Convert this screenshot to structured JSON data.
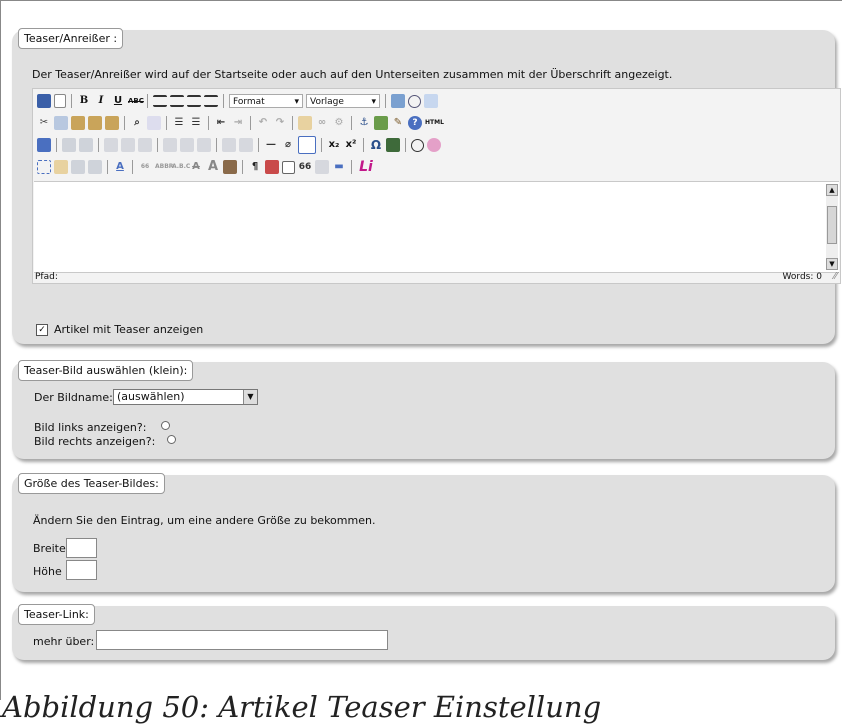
{
  "teaser_panel": {
    "legend": "Teaser/Anreißer :",
    "description": "Der Teaser/Anreißer wird auf der Startseite oder auch auf den Unterseiten zusammen mit der Überschrift angezeigt.",
    "editor": {
      "format_label": "Format",
      "style_label": "Vorlage",
      "path_label": "Pfad:",
      "word_count": "Words: 0",
      "html_label": "HTML",
      "special_char": "Ω",
      "pilcrow": "¶",
      "quote": "66",
      "italic_logo": "Li"
    },
    "show_teaser_label": "Artikel mit Teaser anzeigen",
    "show_teaser_checked": true
  },
  "image_panel": {
    "legend": "Teaser-Bild auswählen (klein):",
    "image_name_label": "Der Bildname:",
    "image_select_value": "(auswählen)",
    "left_label": "Bild links anzeigen?:",
    "right_label": "Bild rechts anzeigen?:"
  },
  "size_panel": {
    "legend": "Größe des Teaser-Bildes:",
    "hint": "Ändern Sie den Eintrag, um eine andere Größe zu bekommen.",
    "width_label": "Breite",
    "height_label": "Höhe"
  },
  "link_panel": {
    "legend": "Teaser-Link:",
    "more_label": "mehr über:"
  },
  "caption": "Abbildung 50: Artikel Teaser Einstellung"
}
